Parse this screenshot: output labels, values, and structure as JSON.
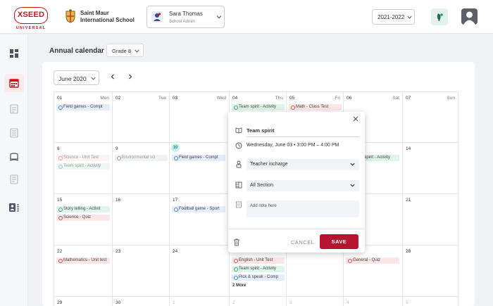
{
  "header": {
    "logo_main": "XSEED",
    "logo_sub": "UNIVERSAL",
    "school_name": "Saint Maur International School",
    "user_name": "Sara Thomas",
    "user_role": "School Admin",
    "academic_year": "2021-2022"
  },
  "sidebar": {
    "items": [
      {
        "icon": "dashboard-icon"
      },
      {
        "icon": "calendar-icon",
        "active": true
      },
      {
        "icon": "planner-icon"
      },
      {
        "icon": "report-icon"
      },
      {
        "icon": "book-icon"
      },
      {
        "icon": "document-icon"
      },
      {
        "icon": "student-list-icon"
      }
    ]
  },
  "page": {
    "title": "Annual calendar",
    "grade": "Grade 8",
    "month": "June 2020"
  },
  "calendar": {
    "weekdays": [
      "Mon",
      "Tue",
      "Wed",
      "Thu",
      "Fri",
      "Sat",
      "Sun"
    ],
    "rows": [
      [
        {
          "day": "01",
          "events": [
            {
              "label": "Field games - Compt",
              "color": "blue"
            }
          ]
        },
        {
          "day": "02",
          "events": []
        },
        {
          "day": "03",
          "events": []
        },
        {
          "day": "04",
          "events": [
            {
              "label": "Team spirit - Activity",
              "color": "green"
            }
          ]
        },
        {
          "day": "05",
          "events": [
            {
              "label": "Math - Class Test",
              "color": "red"
            }
          ]
        },
        {
          "day": "06",
          "events": []
        },
        {
          "day": "07",
          "events": []
        }
      ],
      [
        {
          "day": "8",
          "events": [
            {
              "label": "Science - Unit Test",
              "color": "red",
              "faded": true
            },
            {
              "label": "Team spirit - Activity",
              "color": "green",
              "faded": true
            }
          ]
        },
        {
          "day": "9",
          "events": [
            {
              "label": "Environmental sci",
              "color": "grey"
            }
          ]
        },
        {
          "day": "10",
          "today": true,
          "events": [
            {
              "label": "Field games - Compt",
              "color": "blue"
            }
          ]
        },
        {
          "day": "11",
          "events": []
        },
        {
          "day": "12",
          "events": []
        },
        {
          "day": "13",
          "events": [
            {
              "label": "Team spirit - Activity",
              "color": "green"
            }
          ]
        },
        {
          "day": "14",
          "events": []
        }
      ],
      [
        {
          "day": "15",
          "events": [
            {
              "label": "Story telling - Activit",
              "color": "green"
            },
            {
              "label": "Science - Quiz",
              "color": "red"
            }
          ]
        },
        {
          "day": "16",
          "events": []
        },
        {
          "day": "17",
          "events": [
            {
              "label": "Football game - Sport",
              "color": "blue"
            }
          ]
        },
        {
          "day": "18",
          "events": []
        },
        {
          "day": "19",
          "events": []
        },
        {
          "day": "20",
          "events": []
        },
        {
          "day": "21",
          "events": []
        }
      ],
      [
        {
          "day": "22",
          "events": [
            {
              "label": "Mathematics - Unit test",
              "color": "red"
            }
          ]
        },
        {
          "day": "23",
          "events": []
        },
        {
          "day": "24",
          "events": []
        },
        {
          "day": "25",
          "events": [
            {
              "label": "English - Unit Test",
              "color": "red"
            },
            {
              "label": "Team spirit - Activity",
              "color": "green"
            },
            {
              "label": "Pick & speak - Comp",
              "color": "blue"
            }
          ],
          "more": "2 More"
        },
        {
          "day": "26",
          "events": []
        },
        {
          "day": "27",
          "events": [
            {
              "label": "General - Quiz",
              "color": "red"
            }
          ]
        },
        {
          "day": "28",
          "events": []
        }
      ],
      [
        {
          "day": "29",
          "events": []
        },
        {
          "day": "30",
          "events": []
        },
        {
          "day": "1",
          "muted": true,
          "events": []
        },
        {
          "day": "2",
          "muted": true,
          "events": []
        },
        {
          "day": "3",
          "muted": true,
          "events": []
        },
        {
          "day": "4",
          "muted": true,
          "events": []
        },
        {
          "day": "5",
          "muted": true,
          "events": []
        }
      ]
    ]
  },
  "popup": {
    "title": "Team spirit",
    "datetime": "Wednesday, June 03  •  3:00 PM  –  4:00 PM",
    "teacher_placeholder": "Teacher incharge",
    "section": "All Section",
    "note_placeholder": "Add note here",
    "cancel_label": "CANCEL",
    "save_label": "SAVE"
  },
  "colors": {
    "brand_red": "#c4161c",
    "save_button": "#b5152f",
    "today_highlight": "#c9f0ee"
  }
}
